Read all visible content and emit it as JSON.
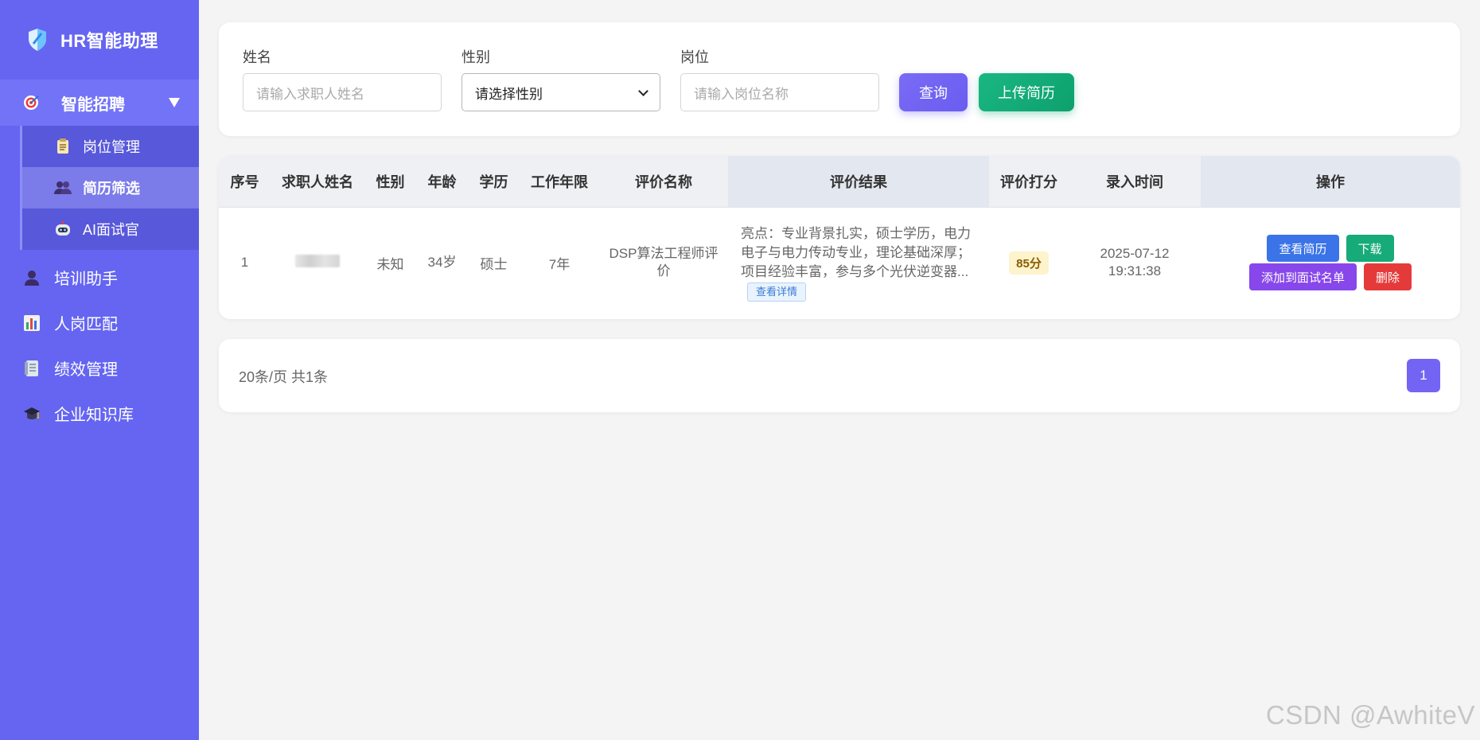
{
  "app": {
    "title": "HR智能助理"
  },
  "sidebar": {
    "recruit": {
      "label": "智能招聘",
      "children": [
        {
          "label": "岗位管理",
          "icon": "clipboard-icon"
        },
        {
          "label": "简历筛选",
          "icon": "users-icon",
          "active": true
        },
        {
          "label": "AI面试官",
          "icon": "robot-icon"
        }
      ]
    },
    "items": [
      {
        "label": "培训助手",
        "icon": "person-icon"
      },
      {
        "label": "人岗匹配",
        "icon": "bar-chart-icon"
      },
      {
        "label": "绩效管理",
        "icon": "ledger-icon"
      },
      {
        "label": "企业知识库",
        "icon": "graduation-cap-icon"
      }
    ]
  },
  "search": {
    "name_label": "姓名",
    "name_placeholder": "请输入求职人姓名",
    "gender_label": "性别",
    "gender_value": "请选择性别",
    "position_label": "岗位",
    "position_placeholder": "请输入岗位名称",
    "query_button": "查询",
    "upload_button": "上传简历"
  },
  "table": {
    "headers": [
      "序号",
      "求职人姓名",
      "性别",
      "年龄",
      "学历",
      "工作年限",
      "评价名称",
      "评价结果",
      "评价打分",
      "录入时间",
      "操作"
    ],
    "rows": [
      {
        "index": "1",
        "name": "",
        "gender": "未知",
        "age": "34岁",
        "education": "硕士",
        "years": "7年",
        "eval_name": "DSP算法工程师评价",
        "result": "亮点：专业背景扎实，硕士学历，电力电子与电力传动专业，理论基础深厚；项目经验丰富，参与多个光伏逆变器...",
        "detail_label": "查看详情",
        "score": "85分",
        "date": "2025-07-12",
        "time": "19:31:38",
        "actions": {
          "view": "查看简历",
          "download": "下载",
          "add": "添加到面试名单",
          "delete": "删除"
        }
      }
    ]
  },
  "pagination": {
    "summary": "20条/页 共1条",
    "current": "1"
  },
  "watermark": "CSDN @AwhiteV",
  "colors": {
    "sidebar": "#6565f2",
    "primary": "#7464f4",
    "success": "#16ab78",
    "danger": "#e53a3a",
    "info": "#3a74e8",
    "purple": "#8747ea"
  }
}
